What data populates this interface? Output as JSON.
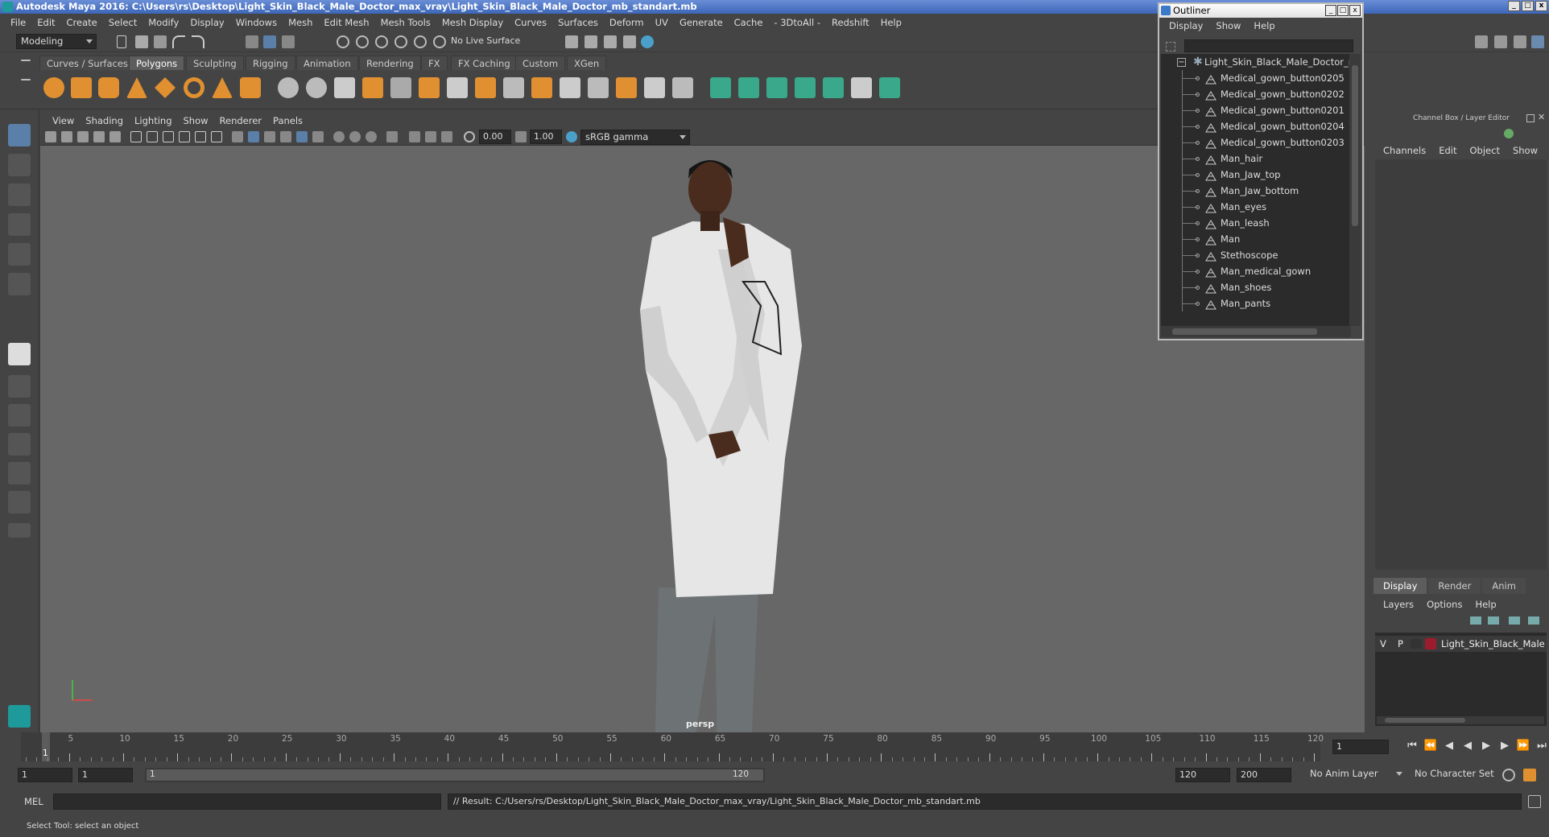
{
  "window": {
    "title": "Autodesk Maya 2016: C:\\Users\\rs\\Desktop\\Light_Skin_Black_Male_Doctor_max_vray\\Light_Skin_Black_Male_Doctor_mb_standart.mb",
    "btn_min": "_",
    "btn_max": "□",
    "btn_close": "x"
  },
  "menubar": [
    "File",
    "Edit",
    "Create",
    "Select",
    "Modify",
    "Display",
    "Windows",
    "Mesh",
    "Edit Mesh",
    "Mesh Tools",
    "Mesh Display",
    "Curves",
    "Surfaces",
    "Deform",
    "UV",
    "Generate",
    "Cache",
    "- 3DtoAll -",
    "Redshift",
    "Help"
  ],
  "statusline": {
    "mode": "Modeling",
    "live_surface": "No Live Surface"
  },
  "shelf_tabs": [
    "Curves / Surfaces",
    "Polygons",
    "Sculpting",
    "Rigging",
    "Animation",
    "Rendering",
    "FX",
    "FX Caching",
    "Custom",
    "XGen"
  ],
  "shelf_active": "Polygons",
  "viewport": {
    "menu": [
      "View",
      "Shading",
      "Lighting",
      "Show",
      "Renderer",
      "Panels"
    ],
    "exposure": "0.00",
    "gamma": "1.00",
    "color_space": "sRGB gamma",
    "camera_label": "persp"
  },
  "outliner": {
    "title": "Outliner",
    "menu": [
      "Display",
      "Show",
      "Help"
    ],
    "root": "Light_Skin_Black_Male_Doctor_nc",
    "root_toggle": "−",
    "items": [
      "Medical_gown_button0205",
      "Medical_gown_button0202",
      "Medical_gown_button0201",
      "Medical_gown_button0204",
      "Medical_gown_button0203",
      "Man_hair",
      "Man_Jaw_top",
      "Man_Jaw_bottom",
      "Man_eyes",
      "Man_leash",
      "Man",
      "Stethoscope",
      "Man_medical_gown",
      "Man_shoes",
      "Man_pants"
    ]
  },
  "channelbox": {
    "title": "Channel Box / Layer Editor",
    "menu": [
      "Channels",
      "Edit",
      "Object",
      "Show"
    ],
    "tabs": [
      "Display",
      "Render",
      "Anim"
    ],
    "active_tab": "Display",
    "layer_menu": [
      "Layers",
      "Options",
      "Help"
    ],
    "layer": {
      "v": "V",
      "p": "P",
      "name": "Light_Skin_Black_Male",
      "color": "#9b1c2e"
    }
  },
  "timeline": {
    "ticks": [
      5,
      10,
      15,
      20,
      25,
      30,
      35,
      40,
      45,
      50,
      55,
      60,
      65,
      70,
      75,
      80,
      85,
      90,
      95,
      100,
      105,
      110,
      115,
      120
    ],
    "current_label": "1",
    "current_frame": "1"
  },
  "range": {
    "start": "1",
    "start2": "1",
    "slider_start": "1",
    "slider_end": "120",
    "end": "120",
    "end2": "200",
    "anim_layer": "No Anim Layer",
    "char_set": "No Character Set"
  },
  "cmdline": {
    "lang": "MEL",
    "result": "// Result: C:/Users/rs/Desktop/Light_Skin_Black_Male_Doctor_max_vray/Light_Skin_Black_Male_Doctor_mb_standart.mb"
  },
  "helpline": "Select Tool: select an object",
  "colors": {
    "accent": "#5a7fa8",
    "shelf_orange": "#e09030",
    "shelf_teal": "#3aa88a"
  }
}
